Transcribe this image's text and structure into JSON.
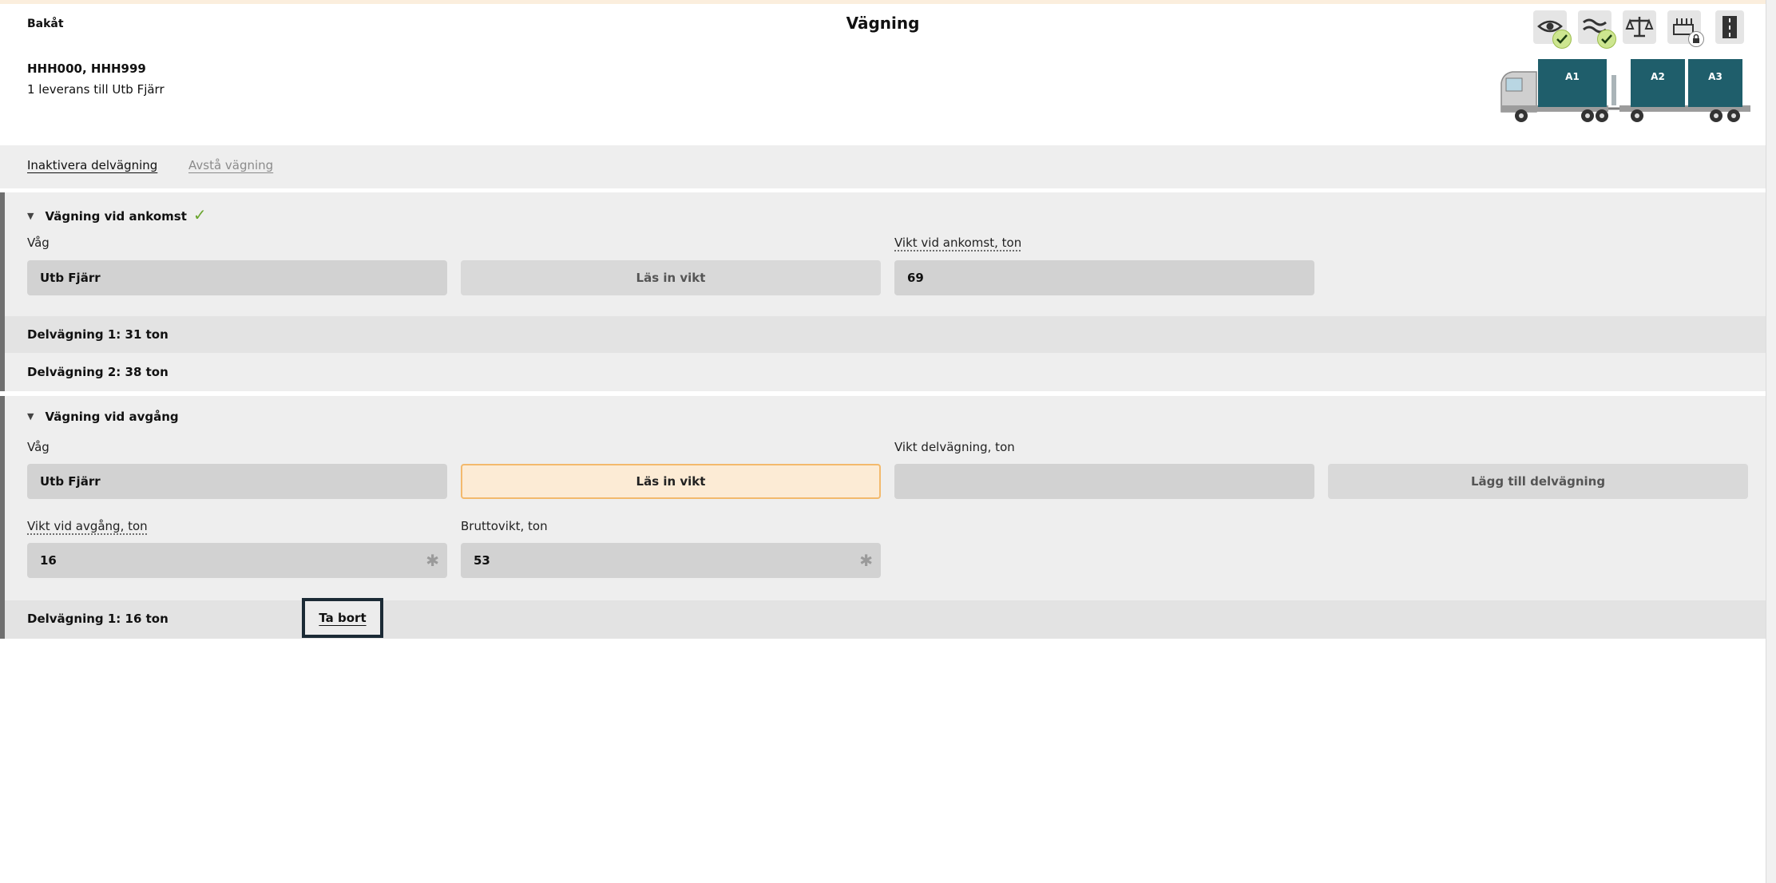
{
  "header": {
    "back_label": "Bakåt",
    "title": "Vägning",
    "vehicles": "HHH000, HHH999",
    "delivery_info": "1 leverans till Utb Fjärr",
    "icons": [
      "eye-icon",
      "wave-icon",
      "scale-icon",
      "crane-icon",
      "road-icon"
    ],
    "cargo_units": [
      "A1",
      "A2",
      "A3"
    ]
  },
  "actions": {
    "deactivate_label": "Inaktivera delvägning",
    "skip_label": "Avstå vägning"
  },
  "arrival": {
    "title": "Vägning vid ankomst",
    "scale_label": "Våg",
    "scale_value": "Utb Fjärr",
    "read_weight_label": "Läs in vikt",
    "weight_label": "Vikt vid ankomst, ton",
    "weight_value": "69",
    "partials": [
      "Delvägning 1: 31 ton",
      "Delvägning 2: 38 ton"
    ]
  },
  "departure": {
    "title": "Vägning vid avgång",
    "scale_label": "Våg",
    "scale_value": "Utb Fjärr",
    "read_weight_label": "Läs in vikt",
    "partial_weight_label": "Vikt delvägning, ton",
    "partial_weight_value": "",
    "add_partial_label": "Lägg till delvägning",
    "weight_label": "Vikt vid avgång, ton",
    "weight_value": "16",
    "gross_label": "Bruttovikt, ton",
    "gross_value": "53",
    "partials": [
      "Delvägning 1: 16 ton"
    ],
    "remove_label": "Ta bort"
  },
  "colors": {
    "accent": "#f3b96c",
    "cargo": "#1f5e6b",
    "ok": "#6aa52e"
  }
}
